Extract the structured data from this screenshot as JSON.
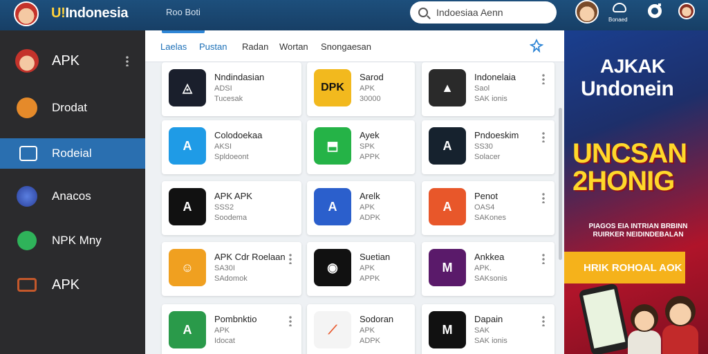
{
  "topbar": {
    "brand_prefix": "U!",
    "brand_name": "Indonesia",
    "subtitle": "Roo Boti",
    "search_value": "Indoesiaa Aenn",
    "cloud_label": "Bonaed"
  },
  "sidebar": {
    "items": [
      {
        "label": "APK",
        "icon": "mascot-icon",
        "color": "#c4332b"
      },
      {
        "label": "Drodat",
        "icon": "android-icon",
        "color": "#e58a2a"
      },
      {
        "label": "Rodeial",
        "icon": "home-icon",
        "color": "#ffffff",
        "active": true
      },
      {
        "label": "Anacos",
        "icon": "globe-icon",
        "color": "#3a5fc2"
      },
      {
        "label": "NPK Mny",
        "icon": "leaf-icon",
        "color": "#2fb35a"
      },
      {
        "label": "APK",
        "icon": "folder-icon",
        "color": "#c4582b"
      }
    ]
  },
  "tabs": [
    {
      "label": "Laelas",
      "active": true
    },
    {
      "label": "Pustan",
      "active": true
    },
    {
      "label": "Radan"
    },
    {
      "label": "Wortan"
    },
    {
      "label": "Snongaesan"
    }
  ],
  "apps": [
    {
      "title": "Nndindasian",
      "line2": "ADSI",
      "line3": "Tucesak",
      "icon": "triangle-app-icon",
      "bg": "#1a1f2c",
      "glyph": "◬"
    },
    {
      "title": "Sarod",
      "line2": "APK",
      "line3": "30000",
      "icon": "dpk-app-icon",
      "bg": "#f2b91e",
      "glyph": "DPK"
    },
    {
      "title": "Indonelaia",
      "line2": "Saol",
      "line3": "SAK ionis",
      "icon": "arrow-app-icon",
      "bg": "#2a2a2a",
      "glyph": "▲"
    },
    {
      "title": "Colodoekaa",
      "line2": "AKSI",
      "line3": "Spldoeont",
      "icon": "store-a-icon",
      "bg": "#1f9be6",
      "glyph": "A"
    },
    {
      "title": "Ayek",
      "line2": "SPK",
      "line3": "APPK",
      "icon": "green-chat-icon",
      "bg": "#25b347",
      "glyph": "⬒"
    },
    {
      "title": "Pndoeskim",
      "line2": "SS30",
      "line3": "Solacer",
      "icon": "dark-a-icon",
      "bg": "#16222e",
      "glyph": "A"
    },
    {
      "title": "APK APK",
      "line2": "SSS2",
      "line3": "Soodema",
      "icon": "slash-a-icon",
      "bg": "#111111",
      "glyph": "A"
    },
    {
      "title": "Arelk",
      "line2": "APK",
      "line3": "ADPK",
      "icon": "blue-a-icon",
      "bg": "#2b5fcc",
      "glyph": "A"
    },
    {
      "title": "Penot",
      "line2": "OAS4",
      "line3": "SAKones",
      "icon": "orange-a-icon",
      "bg": "#e8572a",
      "glyph": "A"
    },
    {
      "title": "APK Cdr Roelaan",
      "line2": "SA30I",
      "line3": "SAdomok",
      "icon": "cat-app-icon",
      "bg": "#f0a020",
      "glyph": "☺"
    },
    {
      "title": "Suetian",
      "line2": "APK",
      "line3": "APPK",
      "icon": "eye-app-icon",
      "bg": "#111111",
      "glyph": "◉"
    },
    {
      "title": "Ankkea",
      "line2": "APK.",
      "line3": "SAKsonis",
      "icon": "art-app-icon",
      "bg": "#5a1a6a",
      "glyph": "M"
    },
    {
      "title": "Pombnktio",
      "line2": "APK",
      "line3": "Idocat",
      "icon": "green-a-icon",
      "bg": "#2a9a4a",
      "glyph": "A"
    },
    {
      "title": "Sodoran",
      "line2": "APK",
      "line3": "ADPK",
      "icon": "orange-slash-icon",
      "bg": "#f4f4f4",
      "glyph": "⟋"
    },
    {
      "title": "Dapain",
      "line2": "SAK",
      "line3": "SAK ionis",
      "icon": "marp-app-icon",
      "bg": "#111111",
      "glyph": "M"
    }
  ],
  "banner": {
    "line1": "AJKAK",
    "line2": "Undonein",
    "headline": "UNCSAN 2HONIG",
    "small": "PIAGOS EIA INTRIAN BRBINN RUIRKER NEIDINDEBALAN",
    "cta": "HRIK ROHOAL AOK"
  }
}
